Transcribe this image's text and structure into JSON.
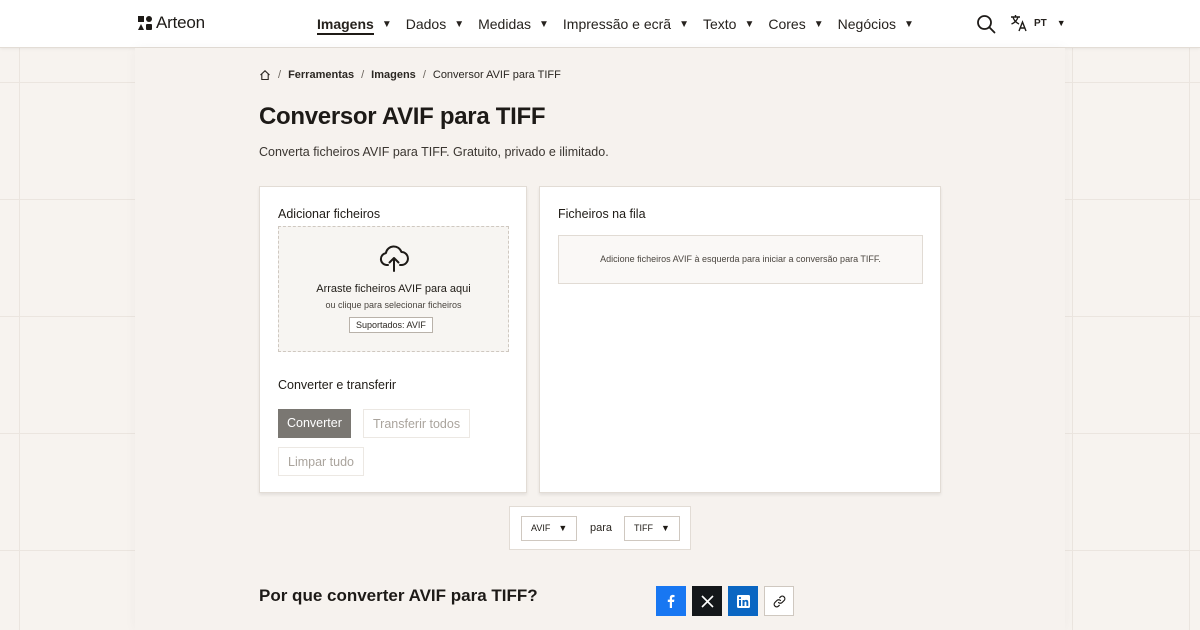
{
  "brand": {
    "name": "Arteon"
  },
  "nav": {
    "items": [
      {
        "label": "Imagens",
        "active": true
      },
      {
        "label": "Dados"
      },
      {
        "label": "Medidas"
      },
      {
        "label": "Impressão e ecrã"
      },
      {
        "label": "Texto"
      },
      {
        "label": "Cores"
      },
      {
        "label": "Negócios"
      }
    ],
    "language": "PT",
    "icons": [
      "search-icon",
      "translate-icon",
      "caret-down-icon"
    ]
  },
  "breadcrumb": {
    "home_icon": "home-icon",
    "items": [
      "Ferramentas",
      "Imagens",
      "Conversor AVIF para TIFF"
    ]
  },
  "page": {
    "title": "Conversor AVIF para TIFF",
    "subtitle": "Converta ficheiros AVIF para TIFF. Gratuito, privado e ilimitado."
  },
  "upload": {
    "heading": "Adicionar ficheiros",
    "icon": "cloud-upload-icon",
    "drop_main": "Arraste ficheiros AVIF para aqui",
    "drop_sub": "ou clique para selecionar ficheiros",
    "supported": "Suportados: AVIF"
  },
  "convert": {
    "heading": "Converter e transferir",
    "convert_label": "Converter",
    "download_all_label": "Transferir todos",
    "clear_label": "Limpar tudo"
  },
  "queue": {
    "heading": "Ficheiros na fila",
    "empty_message": "Adicione ficheiros AVIF à esquerda para iniciar a conversão para TIFF."
  },
  "format": {
    "from": "AVIF",
    "connector": "para",
    "to": "TIFF"
  },
  "why": {
    "title": "Por que converter AVIF para TIFF?"
  },
  "share": {
    "buttons": [
      {
        "icon": "facebook-icon",
        "color": "#1877f2"
      },
      {
        "icon": "x-icon",
        "color": "#14171a"
      },
      {
        "icon": "linkedin-icon",
        "color": "#0a66c2"
      },
      {
        "icon": "link-icon",
        "color": "#ffffff"
      }
    ]
  },
  "colors": {
    "primary_button": "#7a7772",
    "background": "#f7f3ef"
  }
}
